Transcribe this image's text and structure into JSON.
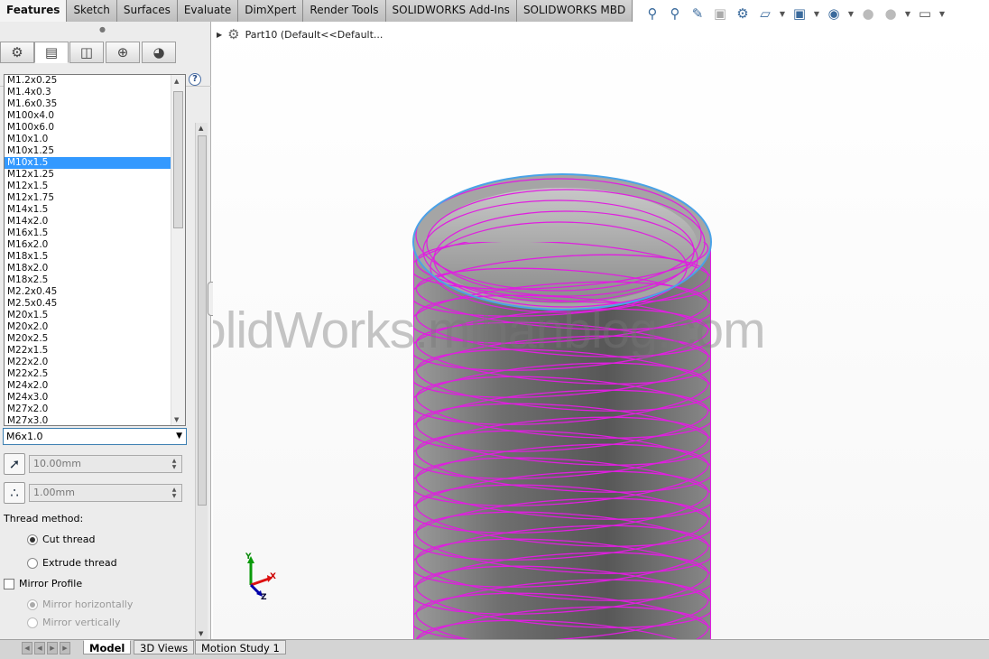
{
  "command_tabs": [
    {
      "label": "Features",
      "active": true
    },
    {
      "label": "Sketch"
    },
    {
      "label": "Surfaces"
    },
    {
      "label": "Evaluate"
    },
    {
      "label": "DimXpert"
    },
    {
      "label": "Render Tools"
    },
    {
      "label": "SOLIDWORKS Add-Ins"
    },
    {
      "label": "SOLIDWORKS MBD"
    }
  ],
  "heads_up_toolbar": {
    "icons": [
      "zoom-to-fit-icon",
      "zoom-to-area-icon",
      "previous-view-icon",
      "section-view-icon",
      "dynamic-annotation-icon",
      "view-orientation-icon",
      "display-style-icon",
      "hide-show-items-icon",
      "edit-appearance-icon",
      "apply-scene-icon",
      "view-settings-icon"
    ]
  },
  "property_panel": {
    "tabs": [
      "featuremanager-icon",
      "propertymanager-icon",
      "configurationmanager-icon",
      "dimxpertmanager-icon",
      "displaymanager-icon"
    ],
    "size_list": {
      "items": [
        "M1.2x0.25",
        "M1.4x0.3",
        "M1.6x0.35",
        "M100x4.0",
        "M100x6.0",
        "M10x1.0",
        "M10x1.25",
        "M10x1.5",
        "M12x1.25",
        "M12x1.5",
        "M12x1.75",
        "M14x1.5",
        "M14x2.0",
        "M16x1.5",
        "M16x2.0",
        "M18x1.5",
        "M18x2.0",
        "M18x2.5",
        "M2.2x0.45",
        "M2.5x0.45",
        "M20x1.5",
        "M20x2.0",
        "M20x2.5",
        "M22x1.5",
        "M22x2.0",
        "M22x2.5",
        "M24x2.0",
        "M24x3.0",
        "M27x2.0",
        "M27x3.0"
      ],
      "selected_index": 7
    },
    "size_combo": "M6x1.0",
    "diameter_value": "10.00mm",
    "pitch_value": "1.00mm",
    "thread_method_label": "Thread method:",
    "cut_thread_label": "Cut thread",
    "extrude_thread_label": "Extrude thread",
    "mirror_profile_label": "Mirror Profile",
    "mirror_horizontally_label": "Mirror horizontally",
    "mirror_vertically_label": "Mirror vertically"
  },
  "viewport": {
    "tree_label": "Part10  (Default<<Default...",
    "watermark": "SolidWorks.mihanblog.com",
    "triad": {
      "x": "X",
      "y": "Y",
      "z": "Z"
    },
    "thread_color": "#e01ee0",
    "edge_color": "#4aa3e8"
  },
  "bottom_tabs": [
    "Model",
    "3D Views",
    "Motion Study 1"
  ]
}
